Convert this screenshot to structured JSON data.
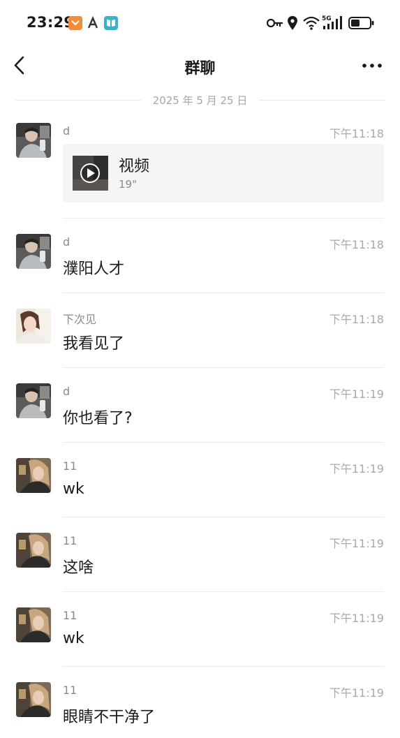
{
  "status_bar": {
    "time": "23:29",
    "network": "5G"
  },
  "nav": {
    "title": "群聊"
  },
  "date_divider": "2025 年 5 月 25 日",
  "messages": [
    {
      "sender": "d",
      "time": "下午11:18",
      "type": "video",
      "video_label": "视频",
      "video_duration": "19\"",
      "avatar": "male-avatar"
    },
    {
      "sender": "d",
      "time": "下午11:18",
      "type": "text",
      "text": "濮阳人才",
      "avatar": "male-avatar"
    },
    {
      "sender": "下次见",
      "time": "下午11:18",
      "type": "text",
      "text": "我看见了",
      "avatar": "female-avatar"
    },
    {
      "sender": "d",
      "time": "下午11:19",
      "type": "text",
      "text": "你也看了?",
      "avatar": "male-avatar"
    },
    {
      "sender": "11",
      "time": "下午11:19",
      "type": "text",
      "text": "wk",
      "avatar": "girl-avatar"
    },
    {
      "sender": "11",
      "time": "下午11:19",
      "type": "text",
      "text": "这啥",
      "avatar": "girl-avatar"
    },
    {
      "sender": "11",
      "time": "下午11:19",
      "type": "text",
      "text": "wk",
      "avatar": "girl-avatar"
    },
    {
      "sender": "11",
      "time": "下午11:19",
      "type": "text",
      "text": "眼睛不干净了",
      "avatar": "girl-avatar"
    }
  ]
}
